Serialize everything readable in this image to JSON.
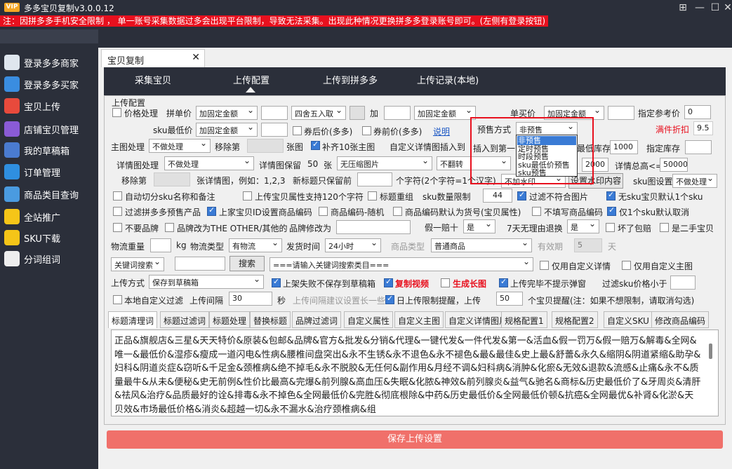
{
  "app": {
    "title": "多多宝贝复制v3.0.0.12",
    "vip": "VIP",
    "warning": "注：因拼多多手机安全限制 ， 单一账号采集数据过多会出现平台限制，导致无法采集。出现此种情况更换拼多多登录账号即可。(左侧有登录按钮)"
  },
  "sidebar": {
    "items": [
      {
        "label": "登录多多商家",
        "icon": "monitor-icon",
        "color": "#dfe6ee"
      },
      {
        "label": "登录多多买家",
        "icon": "phone-icon",
        "color": "#3a8de0"
      },
      {
        "label": "宝贝上传",
        "icon": "cloud-upload-icon",
        "color": "#e84a3c"
      },
      {
        "label": "店铺宝贝管理",
        "icon": "user-icon",
        "color": "#8a5bd6"
      },
      {
        "label": "我的草稿箱",
        "icon": "pie-chart-icon",
        "color": "#4a7bd0"
      },
      {
        "label": "订单管理",
        "icon": "order-icon",
        "color": "#2f8fe0"
      },
      {
        "label": "商品类目查询",
        "icon": "grid-icon",
        "color": "#4a9be0"
      },
      {
        "label": "全站推广",
        "icon": "promo-icon",
        "color": "#f5c518"
      },
      {
        "label": "SKU下载",
        "icon": "link-icon",
        "color": "#f5c518"
      },
      {
        "label": "分词组词",
        "icon": "hammer-icon",
        "color": "#eeeeee"
      }
    ]
  },
  "doc_tab": {
    "label": "宝贝复制",
    "close": "✕"
  },
  "nav": {
    "tabs": [
      "采集宝贝",
      "上传配置",
      "上传到拼多多",
      "上传记录(本地)"
    ]
  },
  "group": {
    "title": "上传配置"
  },
  "row1": {
    "price_process": "价格处理",
    "unit_price": "拼单价",
    "unit_price_mode": "加固定金额",
    "round": "四舍五入取",
    "add": "加",
    "add_mode": "加固定金额",
    "single_price": "单买价",
    "single_mode": "加固定金额",
    "ref_price": "指定参考价",
    "ref_value": "0"
  },
  "row2": {
    "sku_min": "sku最低价",
    "sku_mode": "加固定金额",
    "after_coupon": "券后价(多多)",
    "coupon_price": "券前价(多多)",
    "explain": "说明",
    "presale": "预售方式",
    "presale_value": "非预售",
    "full_discount": "满件折扣",
    "full_discount_value": "9.5"
  },
  "row3": {
    "main_img": "主图处理",
    "main_img_mode": "不做处理",
    "remove": "移除第",
    "img_unit": "张图",
    "fill10": "补齐10张主图",
    "custom_detail": "自定义详情图插入到",
    "insert_first": "插入到第一",
    "min_stock": "最低库存",
    "min_stock_value": "1000",
    "spec_stock": "指定库存"
  },
  "row4": {
    "detail_img": "详情图处理",
    "detail_mode": "不做处理",
    "keep": "详情图保留",
    "keep_value": "50",
    "zhang": "张",
    "no_compress": "无压缩图片",
    "no_flip": "不翻转",
    "stock_val": "2000",
    "total_detail": "详情总高<=",
    "total_value": "50000"
  },
  "row5": {
    "remove": "移除第",
    "example": "张详情图，例如：1,2,3",
    "new_title": "新标题只保留前",
    "chars": "个字符(2个字符=1个汉字)",
    "no_watermark": "不加水印",
    "set_watermark": "设置水印内容",
    "sku_img": "sku图设置",
    "sku_img_value": "不做处理"
  },
  "row6": {
    "auto_cut": "自动切分sku名称和备注",
    "upload_attr": "上传宝贝属性支持120个字符",
    "title_regroup": "标题重组",
    "sku_limit": "sku数量限制",
    "sku_limit_value": "44",
    "filter_bad": "过滤不符合图片",
    "no_sku": "无sku宝贝默认1个sku"
  },
  "row7": {
    "filter_presale": "过滤拼多多预售产品",
    "merchant_code": "上家宝贝ID设置商品编码",
    "code_random": "商品编码-随机",
    "code_default": "商品编码默认为货号(宝贝属性)",
    "no_fill_code": "不填写商品编码",
    "only1": "仅1个sku默认取消"
  },
  "row8": {
    "no_brand": "不要品牌",
    "brand_other": "品牌改为THE OTHER/其他的",
    "brand_change": "品牌修改为",
    "fake_ten": "假一赔十",
    "fake_value": "是",
    "seven_day": "7天无理由退换",
    "seven_value": "是",
    "broken": "坏了包赔",
    "second_hand": "是二手宝贝"
  },
  "row9": {
    "weight": "物流重量",
    "kg": "kg",
    "logistics": "物流类型",
    "logistics_value": "有物流",
    "ship_time": "发货时间",
    "ship_value": "24小时",
    "goods_type": "商品类型",
    "goods_value": "普通商品",
    "validity": "有效期",
    "validity_value": "5",
    "day": "天"
  },
  "row10": {
    "keyword_mode": "关键词搜索",
    "search": "搜索",
    "category_placeholder": "===请输入关键词搜索类目===",
    "only_custom_detail": "仅用自定义详情",
    "only_custom_main": "仅用自定义主图"
  },
  "row11": {
    "upload_mode": "上传方式",
    "upload_value": "保存到草稿箱",
    "fail_no_save": "上架失败不保存到草稿箱",
    "copy_video": "复制视频",
    "gen_long": "生成长图",
    "no_popup": "上传完毕不提示弹窗",
    "filter_sku": "过滤sku价格小于"
  },
  "row12": {
    "local_filter": "本地自定义过滤",
    "interval": "上传间隔",
    "interval_value": "30",
    "sec": "秒",
    "interval_tip": "上传间隔建议设置长一些",
    "daily_limit": "日上传限制提醒，上传",
    "daily_value": "50",
    "daily_tip": "个宝贝提醒(注：如果不想限制，请取消勾选)"
  },
  "subtabs": [
    "标题清理词",
    "标题过滤词",
    "标题处理",
    "替换标题",
    "品牌过滤词",
    "自定义属性",
    "自定义主图",
    "自定义详情图片",
    "规格配置1",
    "规格配置2",
    "自定义SKU",
    "修改商品编码"
  ],
  "title_words": "正品&旗舰店&三星&天天特价&原装&包邮&品牌&官方&批发&分销&代理&一键代发&一件代发&第一&活血&假一罚万&假一赔万&解毒&全网&唯一&最低价&湿疹&瘦成一道闪电&性病&腰椎间盘突出&永不生锈&永不退色&永不褪色&最&最佳&史上最&舒蕾&永久&缩阴&阴道紧缩&助孕&妇科&阴道炎症&窃听&千足金&颈椎病&绝不掉毛&永不脱胶&无任何&副作用&月经不调&妇科病&消肿&化瘀&无效&退款&流感&止痛&永不&质量最牛&从未&便秘&史无前例&性价比最高&完爆&前列腺&高血压&失眠&化脓&神效&前列腺炎&益气&驰名&商标&历史最低价了&牙周炎&清肝&祛风&治疗&品质最好的诠&排毒&永不掉色&全网最低价&完胜&彻底根除&中药&历史最低价&全网最低价顿&抗癌&全网最优&补肾&化淤&天贝效&市场最低价格&消炎&超越一切&永不漏水&治疗颈椎病&组",
  "presale_dropdown": [
    "非预售",
    "定时预售",
    "时段预售",
    "sku最低价预售",
    "sku预售"
  ],
  "save": "保存上传设置"
}
